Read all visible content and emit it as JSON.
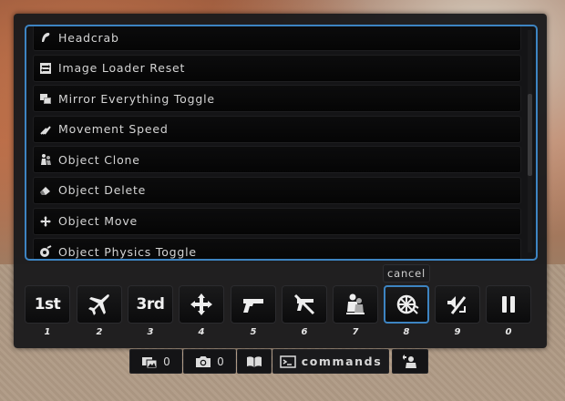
{
  "commands": [
    {
      "label": "Headcrab",
      "icon": "headcrab-icon"
    },
    {
      "label": "Image Loader Reset",
      "icon": "image-loader-reset-icon"
    },
    {
      "label": "Mirror Everything Toggle",
      "icon": "mirror-icon"
    },
    {
      "label": "Movement Speed",
      "icon": "speed-icon"
    },
    {
      "label": "Object Clone",
      "icon": "clone-icon"
    },
    {
      "label": "Object Delete",
      "icon": "eraser-icon"
    },
    {
      "label": "Object Move",
      "icon": "move-arrows-icon"
    },
    {
      "label": "Object Physics Toggle",
      "icon": "physics-icon"
    }
  ],
  "tooltip": {
    "label": "cancel"
  },
  "hotbar": [
    {
      "num": "1",
      "text": "1st",
      "icon": "first-person-icon",
      "active": false
    },
    {
      "num": "2",
      "text": "",
      "icon": "airplane-icon",
      "active": false
    },
    {
      "num": "3",
      "text": "3rd",
      "icon": "third-person-icon",
      "active": false
    },
    {
      "num": "4",
      "text": "",
      "icon": "move-arrows-icon",
      "active": false
    },
    {
      "num": "5",
      "text": "",
      "icon": "pistol-icon",
      "active": false
    },
    {
      "num": "6",
      "text": "",
      "icon": "no-weapon-icon",
      "active": false
    },
    {
      "num": "7",
      "text": "",
      "icon": "clone-figure-icon",
      "active": false
    },
    {
      "num": "8",
      "text": "",
      "icon": "turbine-icon",
      "active": true
    },
    {
      "num": "9",
      "text": "",
      "icon": "mute-icon",
      "active": false
    },
    {
      "num": "0",
      "text": "",
      "icon": "pause-icon",
      "active": false
    }
  ],
  "bottombar": {
    "images_count": "0",
    "camera_count": "0",
    "commands_label": "commands"
  }
}
